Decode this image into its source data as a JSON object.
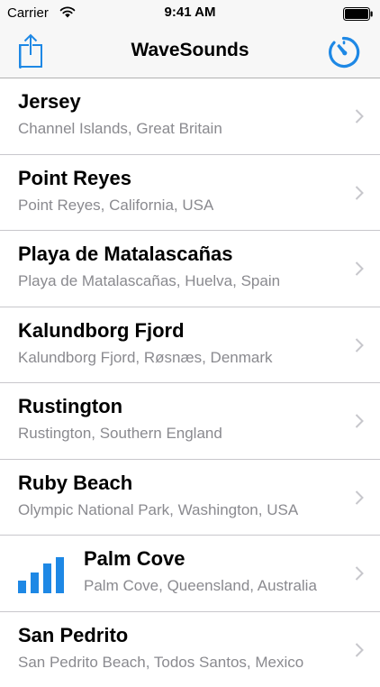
{
  "status_bar": {
    "carrier": "Carrier",
    "time": "9:41 AM",
    "wifi_icon": "wifi-icon",
    "battery_icon": "battery-icon"
  },
  "nav_bar": {
    "title": "WaveSounds",
    "left_icon": "share-icon",
    "right_icon": "timer-icon"
  },
  "colors": {
    "accent": "#1e88e5",
    "subtitle": "#8a8a8f",
    "separator": "#c8c7cc",
    "bar_background": "#f7f7f7"
  },
  "locations": [
    {
      "title": "Jersey",
      "subtitle": "Channel Islands, Great Britain"
    },
    {
      "title": "Point Reyes",
      "subtitle": "Point Reyes, California, USA"
    },
    {
      "title": "Playa de Matalascañas",
      "subtitle": "Playa de Matalascañas, Huelva, Spain"
    },
    {
      "title": "Kalundborg Fjord",
      "subtitle": "Kalundborg Fjord, Røsnæs, Denmark"
    },
    {
      "title": "Rustington",
      "subtitle": "Rustington, Southern England"
    },
    {
      "title": "Ruby Beach",
      "subtitle": "Olympic National Park, Washington, USA"
    },
    {
      "title": "Palm Cove",
      "subtitle": "Palm Cove, Queensland, Australia",
      "now_playing": true,
      "playing_icon": "equalizer-bars-icon"
    },
    {
      "title": "San Pedrito",
      "subtitle": "San Pedrito Beach, Todos Santos, Mexico"
    }
  ]
}
